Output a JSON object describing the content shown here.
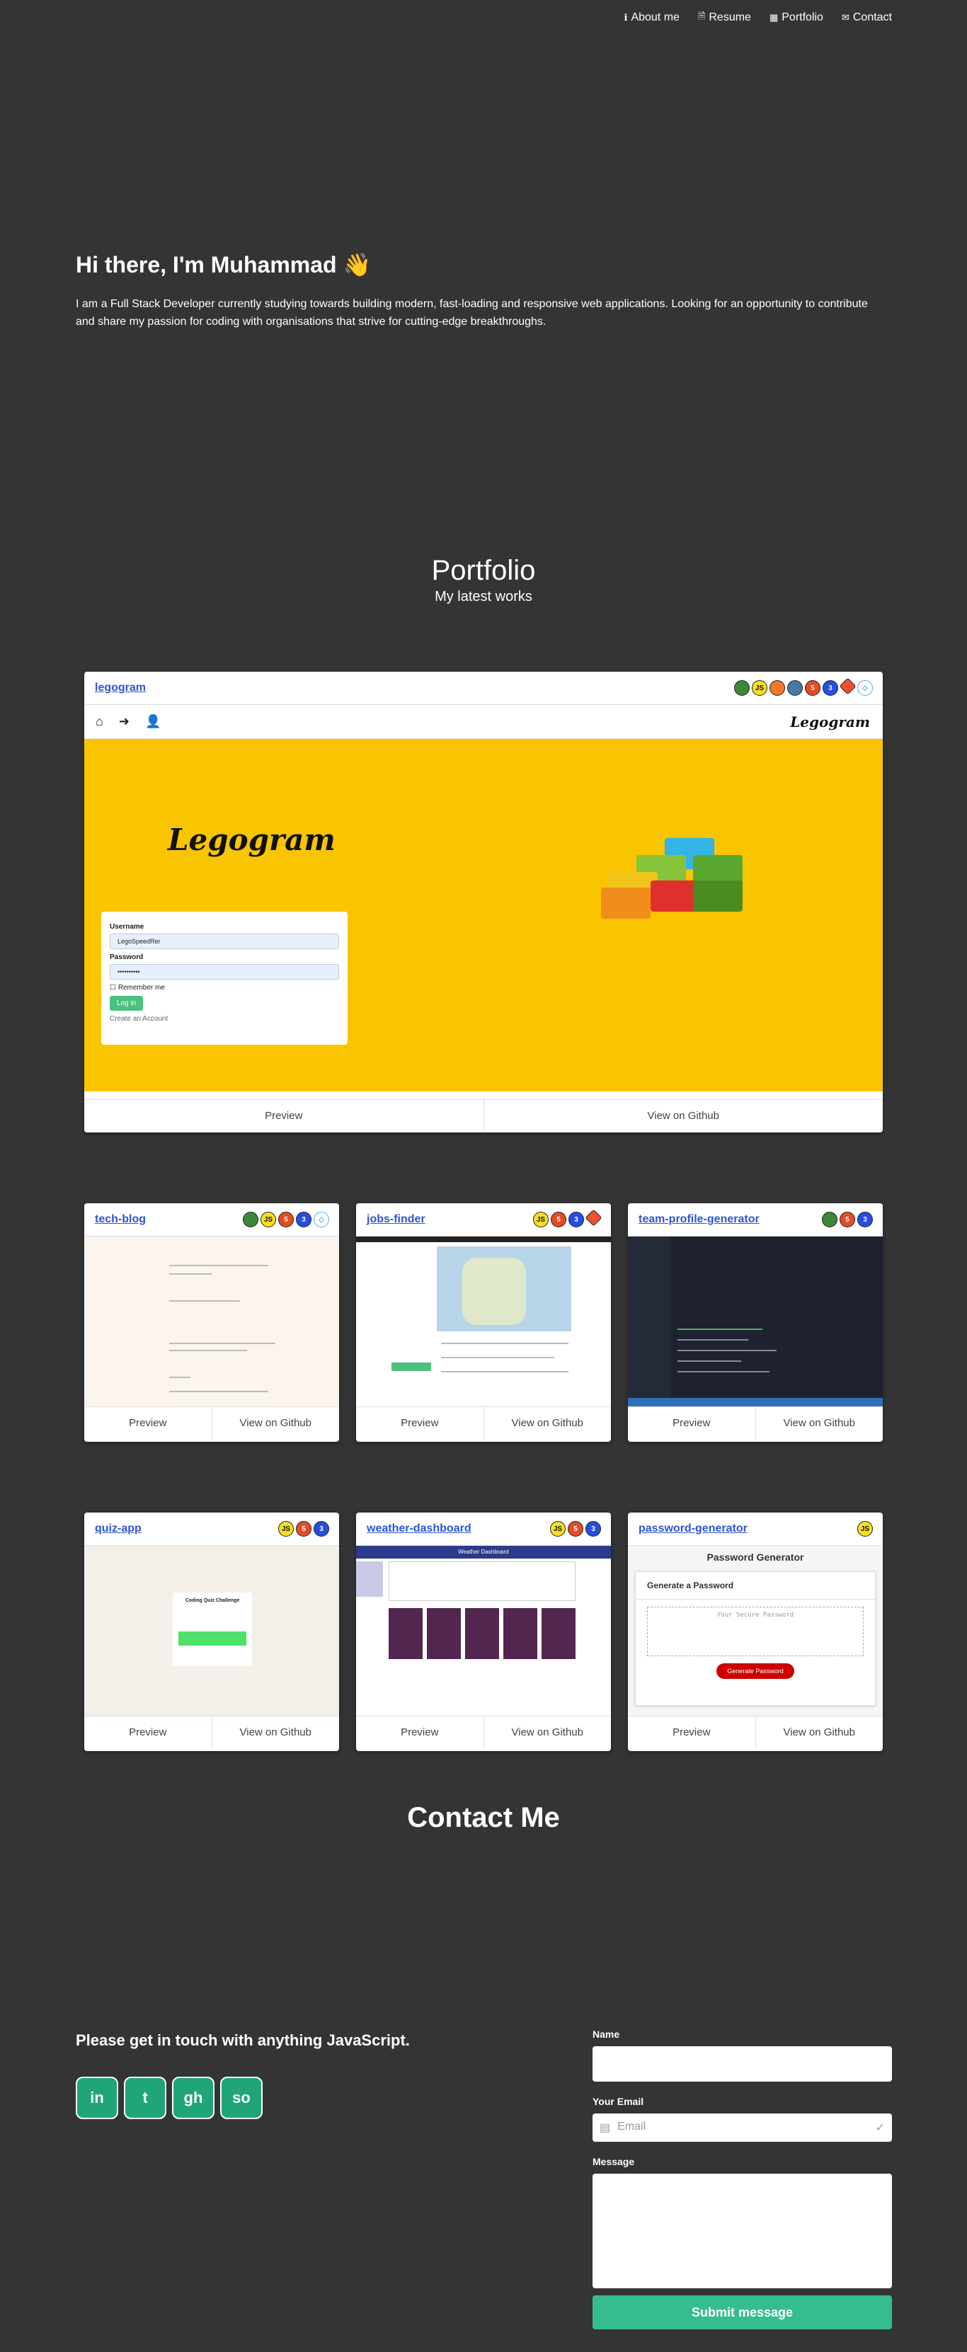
{
  "nav": {
    "links": [
      {
        "label": "About me",
        "icon": "info-icon"
      },
      {
        "label": "Resume",
        "icon": "document-icon"
      },
      {
        "label": "Portfolio",
        "icon": "table-icon"
      },
      {
        "label": "Contact",
        "icon": "envelope-icon"
      }
    ]
  },
  "hero": {
    "greeting": "Hi there, I'm Muhammad 👋",
    "bio": "I am a Full Stack Developer currently studying towards building modern, fast-loading and responsive web applications. Looking for an opportunity to contribute and share my passion for coding with organisations that strive for cutting-edge breakthroughs."
  },
  "portfolio": {
    "title": "Portfolio",
    "subtitle": "My latest works",
    "preview_label": "Preview",
    "github_label": "View on Github",
    "projects": [
      {
        "name": "legogram",
        "tech": [
          "node",
          "js",
          "handlebars",
          "mysql",
          "html",
          "css",
          "git",
          "sequelize"
        ]
      },
      {
        "name": "tech-blog",
        "tech": [
          "node",
          "js",
          "html",
          "css",
          "sequelize"
        ]
      },
      {
        "name": "jobs-finder",
        "tech": [
          "js",
          "html",
          "css",
          "git"
        ]
      },
      {
        "name": "team-profile-generator",
        "tech": [
          "node",
          "html",
          "css"
        ]
      },
      {
        "name": "quiz-app",
        "tech": [
          "js",
          "html",
          "css"
        ]
      },
      {
        "name": "weather-dashboard",
        "tech": [
          "js",
          "html",
          "css"
        ]
      },
      {
        "name": "password-generator",
        "tech": [
          "js"
        ]
      }
    ],
    "legogram_preview": {
      "brand": "Legogram",
      "username_label": "Username",
      "username_value": "LegoSpeedRer",
      "password_label": "Password",
      "password_value": "••••••••••",
      "remember_label": "Remember me",
      "login_label": "Log in",
      "create_label": "Create an Account"
    },
    "quiz_preview": {
      "title": "Coding Quiz Challenge"
    },
    "weather_preview": {
      "title": "Weather Dashboard"
    },
    "pw_preview": {
      "title": "Password Generator",
      "subtitle": "Generate a Password",
      "placeholder": "Your Secure Password",
      "button": "Generate Password"
    }
  },
  "contact": {
    "title": "Contact Me",
    "tagline": "Please get in touch with anything JavaScript.",
    "socials": [
      {
        "name": "linkedin",
        "glyph": "in"
      },
      {
        "name": "twitter",
        "glyph": "t"
      },
      {
        "name": "github",
        "glyph": "gh"
      },
      {
        "name": "stackoverflow",
        "glyph": "so"
      }
    ],
    "name_label": "Name",
    "email_label": "Your Email",
    "email_placeholder": "Email",
    "message_label": "Message",
    "submit_label": "Submit message"
  }
}
